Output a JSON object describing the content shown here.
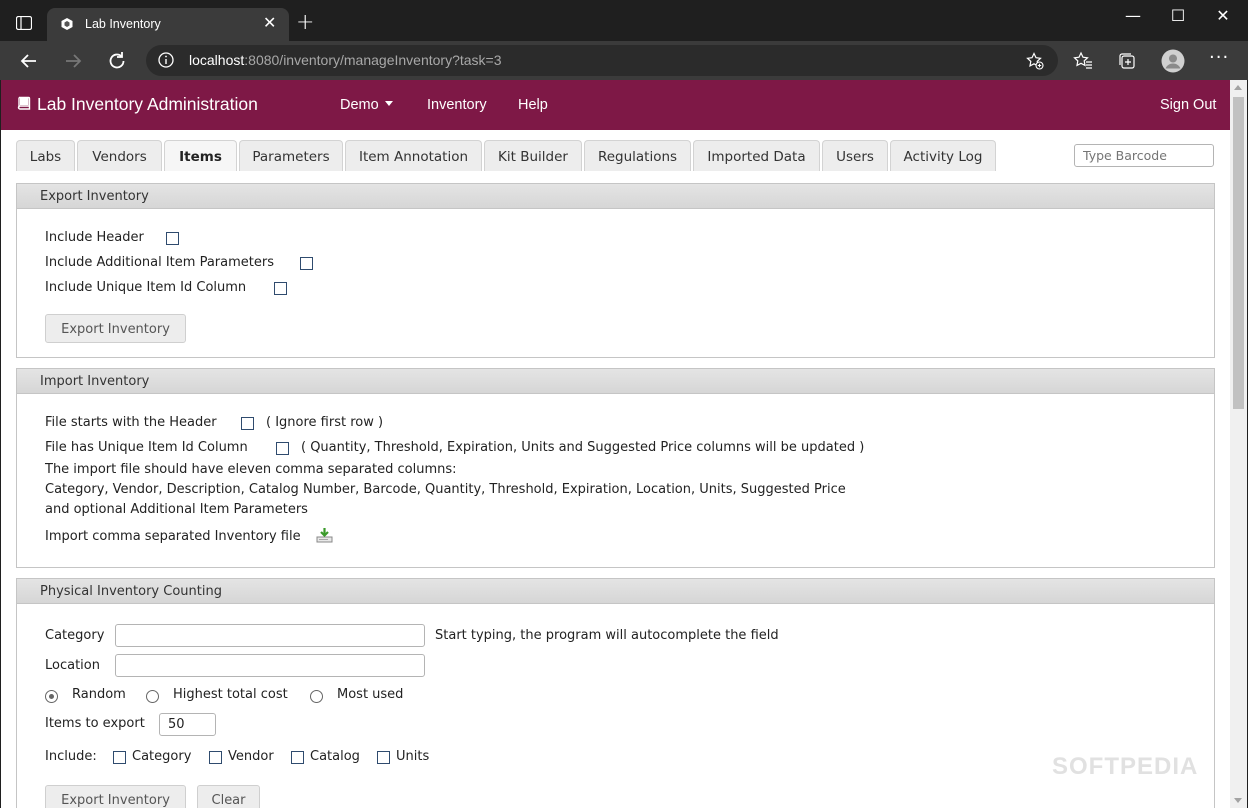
{
  "browser": {
    "tab_title": "Lab Inventory",
    "url_host": "localhost",
    "url_path": ":8080/inventory/manageInventory?task=3"
  },
  "app": {
    "brand": "Lab Inventory Administration",
    "nav": [
      {
        "label": "Demo"
      },
      {
        "label": "Inventory"
      },
      {
        "label": "Help"
      }
    ],
    "sign_out": "Sign Out",
    "accent_color": "#7e1846"
  },
  "tabs": [
    {
      "label": "Labs"
    },
    {
      "label": "Vendors"
    },
    {
      "label": "Items",
      "active": true
    },
    {
      "label": "Parameters"
    },
    {
      "label": "Item Annotation"
    },
    {
      "label": "Kit Builder"
    },
    {
      "label": "Regulations"
    },
    {
      "label": "Imported Data"
    },
    {
      "label": "Users"
    },
    {
      "label": "Activity Log"
    }
  ],
  "barcode_placeholder": "Type Barcode",
  "export": {
    "title": "Export Inventory",
    "options": [
      {
        "label": "Include Header",
        "checked": false
      },
      {
        "label": "Include Additional Item Parameters",
        "checked": false
      },
      {
        "label": "Include Unique Item Id Column",
        "checked": false
      }
    ],
    "button": "Export Inventory"
  },
  "import": {
    "title": "Import Inventory",
    "header_label": "File starts with the Header",
    "header_note": "( Ignore first row )",
    "unique_label": "File has Unique Item Id Column",
    "unique_note": "( Quantity, Threshold, Expiration, Units and Suggested Price columns will be updated )",
    "desc1": "The import file should have eleven comma separated columns:",
    "desc2": "Category, Vendor, Description, Catalog Number, Barcode, Quantity, Threshold, Expiration, Location, Units, Suggested Price",
    "desc3": "and optional Additional Item Parameters",
    "file_label": "Import comma separated Inventory file"
  },
  "physical": {
    "title": "Physical Inventory Counting",
    "category_label": "Category",
    "category_value": "",
    "category_hint": "Start typing, the program will autocomplete the field",
    "location_label": "Location",
    "location_value": "",
    "radios": [
      {
        "label": "Random",
        "selected": true
      },
      {
        "label": "Highest total cost",
        "selected": false
      },
      {
        "label": "Most used",
        "selected": false
      }
    ],
    "items_label": "Items to export",
    "items_value": "50",
    "include_label": "Include:",
    "include_options": [
      {
        "label": "Category",
        "checked": false
      },
      {
        "label": "Vendor",
        "checked": false
      },
      {
        "label": "Catalog",
        "checked": false
      },
      {
        "label": "Units",
        "checked": false
      }
    ],
    "export_button": "Export Inventory",
    "clear_button": "Clear"
  },
  "watermark": "SOFTPEDIA"
}
